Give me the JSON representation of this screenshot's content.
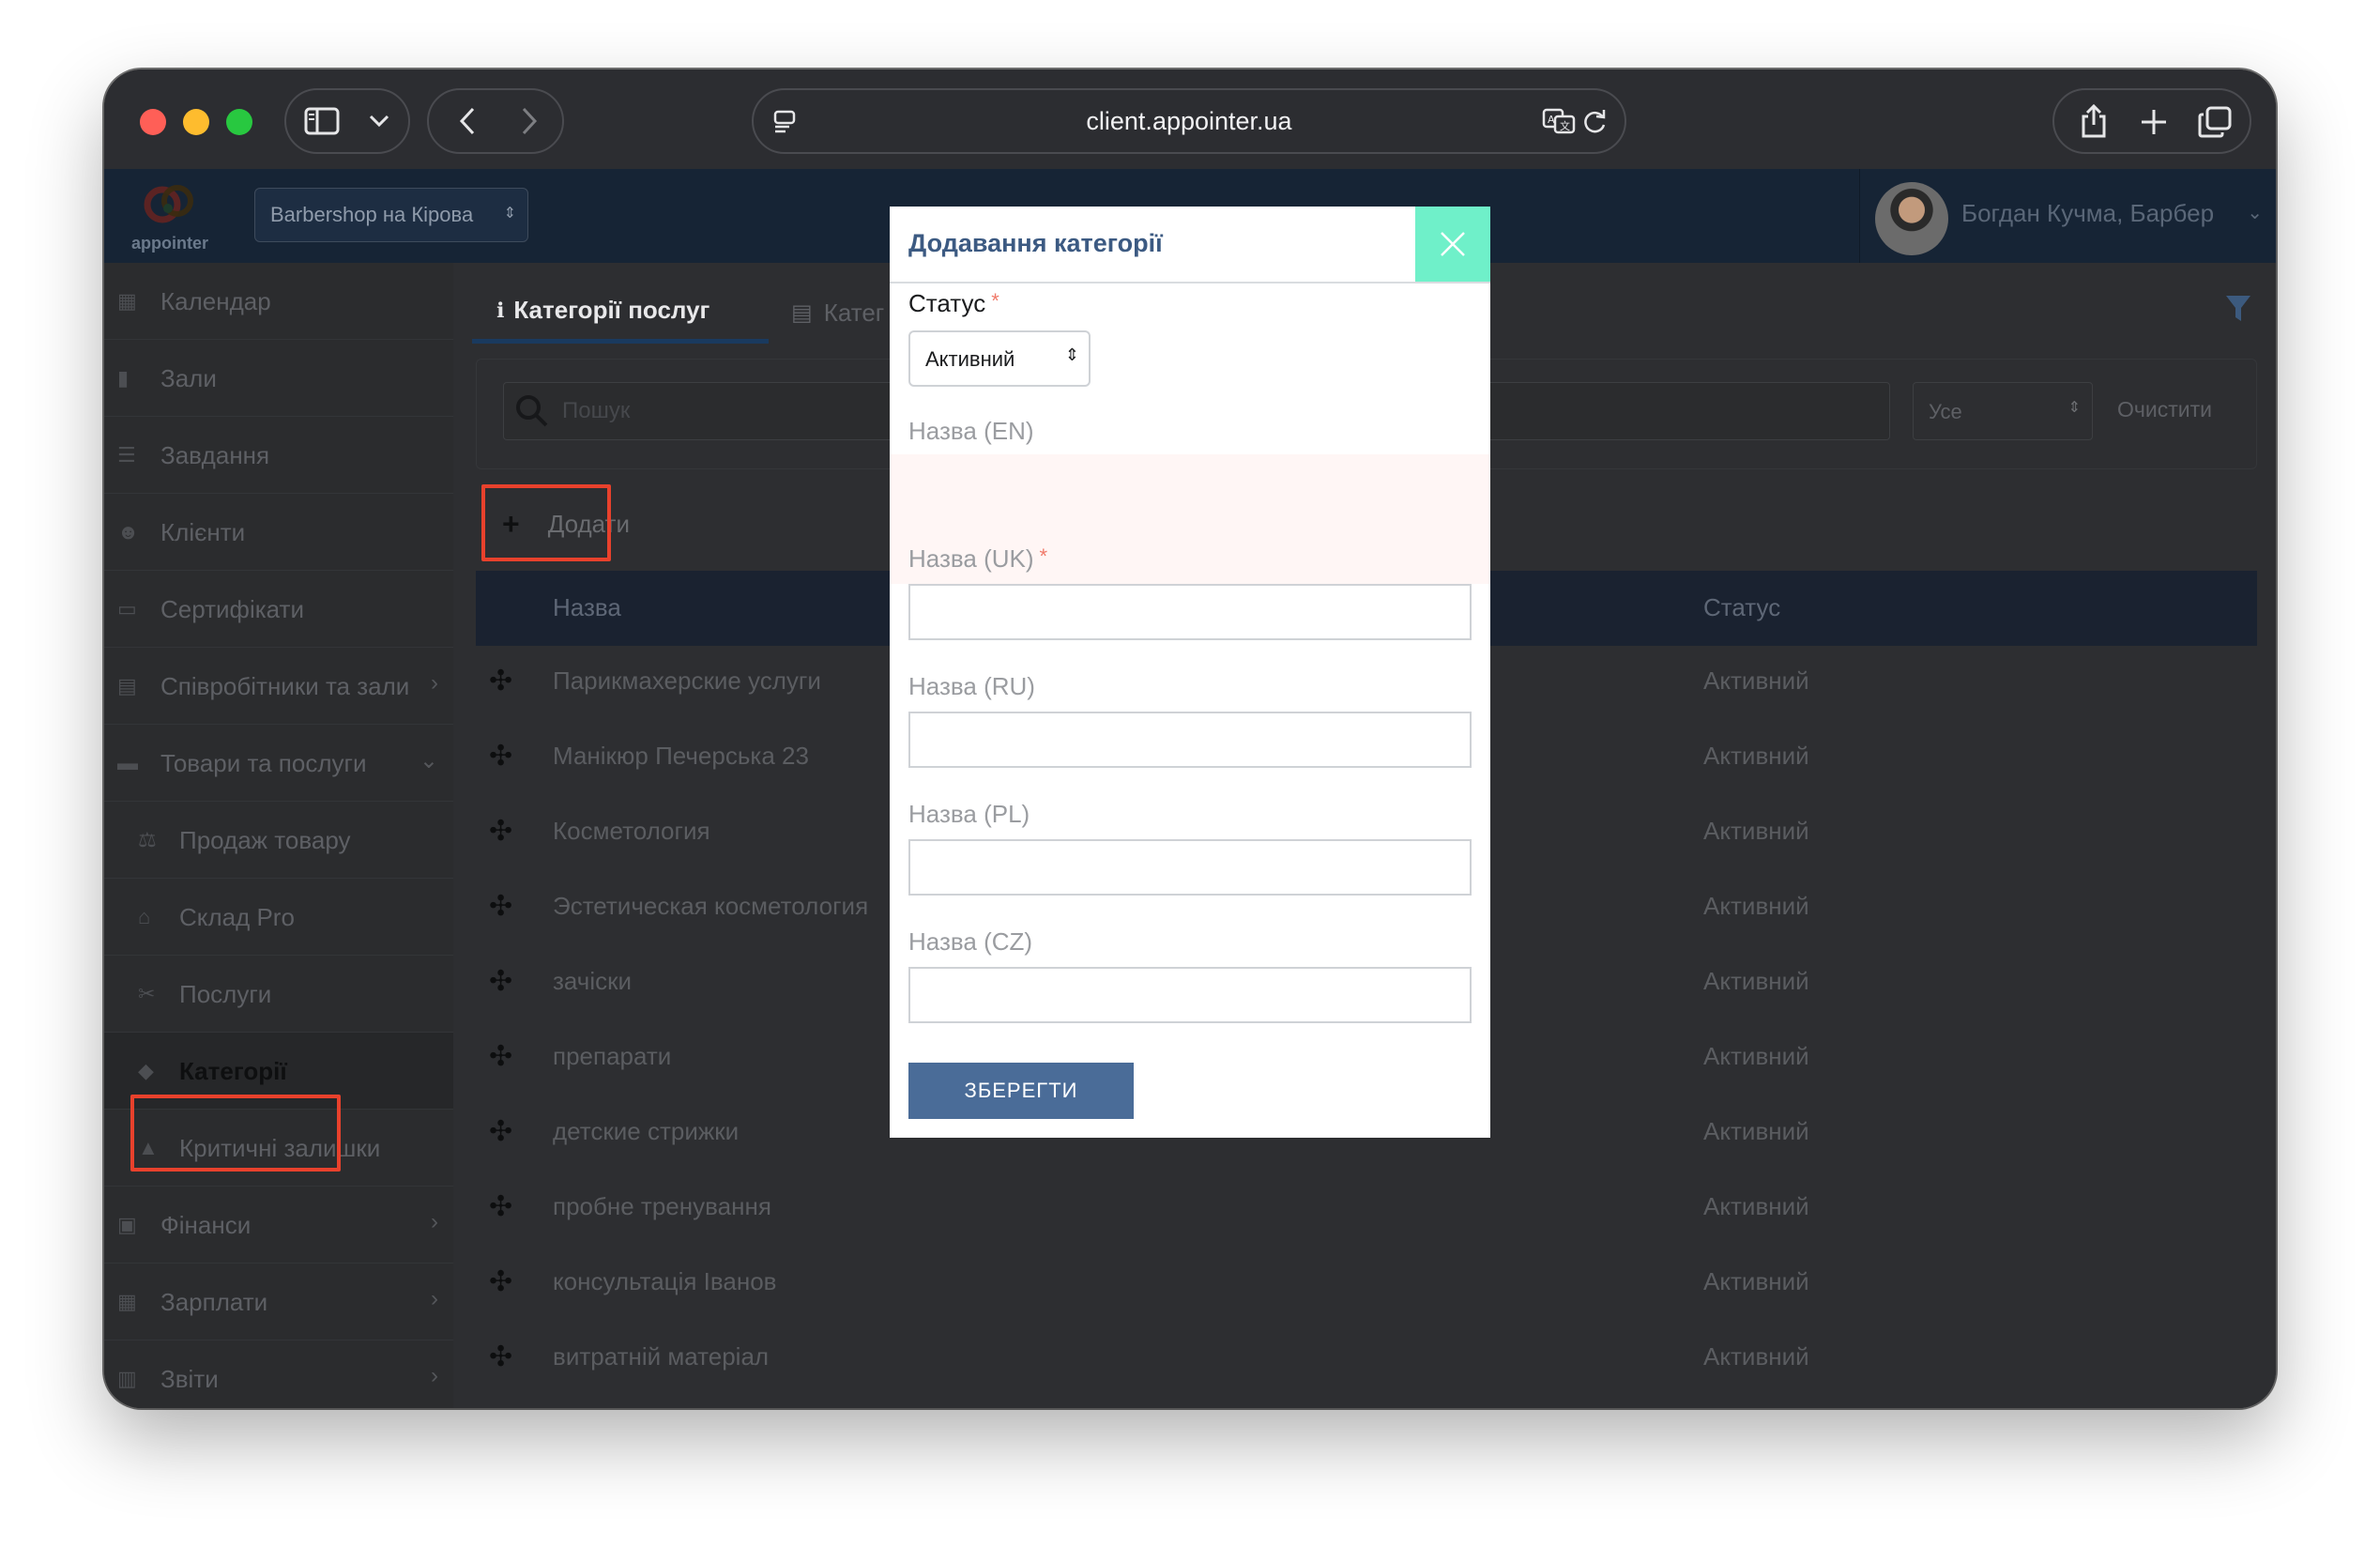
{
  "browser": {
    "url": "client.appointer.ua"
  },
  "app": {
    "logo_text": "appointer",
    "branch": "Barbershop на Кірова",
    "user_name": "Богдан Кучма, Барбер"
  },
  "sidebar": {
    "items": [
      {
        "label": "Календар",
        "icon": "calendar-icon"
      },
      {
        "label": "Зали",
        "icon": "bookmark-icon"
      },
      {
        "label": "Завдання",
        "icon": "tasks-icon"
      },
      {
        "label": "Клієнти",
        "icon": "users-icon"
      },
      {
        "label": "Сертифікати",
        "icon": "certificate-icon"
      },
      {
        "label": "Співробітники та зали",
        "icon": "id-card-icon"
      },
      {
        "label": "Товари та послуги",
        "icon": "credit-card-icon"
      },
      {
        "label": "Продаж товару",
        "icon": "scales-icon"
      },
      {
        "label": "Склад Pro",
        "icon": "warehouse-icon"
      },
      {
        "label": "Послуги",
        "icon": "scissors-icon"
      },
      {
        "label": "Категорії",
        "icon": "tag-icon"
      },
      {
        "label": "Критичні залишки",
        "icon": "warning-icon"
      },
      {
        "label": "Фінанси",
        "icon": "money-icon"
      },
      {
        "label": "Зарплати",
        "icon": "calculator-icon"
      },
      {
        "label": "Звіти",
        "icon": "bar-chart-icon"
      }
    ]
  },
  "main": {
    "tabs": [
      {
        "label": "Категорії послуг",
        "icon": "info-icon"
      },
      {
        "label": "Катег",
        "icon": "id-card-icon"
      }
    ],
    "search_placeholder": "Пошук",
    "status_filter": "Усе",
    "clear_label": "Очистити",
    "add_label": "Додати",
    "columns": {
      "name": "Назва",
      "status": "Статус"
    },
    "rows": [
      {
        "name": "Парикмахерские услуги",
        "status": "Активний"
      },
      {
        "name": "Манікюр Печерська 23",
        "status": "Активний"
      },
      {
        "name": "Косметология",
        "status": "Активний"
      },
      {
        "name": "Эстетическая косметология",
        "status": "Активний"
      },
      {
        "name": "зачіски",
        "status": "Активний"
      },
      {
        "name": "препарати",
        "status": "Активний"
      },
      {
        "name": "детские стрижки",
        "status": "Активний"
      },
      {
        "name": "пробне тренування",
        "status": "Активний"
      },
      {
        "name": "консультація Іванов",
        "status": "Активний"
      },
      {
        "name": "витратній матеріал",
        "status": "Активний"
      }
    ]
  },
  "modal": {
    "title": "Додавання категорії",
    "status_label": "Статус",
    "status_value": "Активний",
    "required_mark": "*",
    "fields": [
      {
        "label": "Назва (EN)",
        "value": ""
      },
      {
        "label": "Назва (UK)",
        "value": ""
      },
      {
        "label": "Назва (RU)",
        "value": ""
      },
      {
        "label": "Назва (PL)",
        "value": ""
      },
      {
        "label": "Назва (CZ)",
        "value": ""
      }
    ],
    "save_label": "ЗБЕРЕГТИ"
  },
  "colors": {
    "highlight": "#e8412c",
    "modal_title": "#3c5a82",
    "close_button": "#6ff0c9",
    "save_button": "#4a6c98"
  }
}
